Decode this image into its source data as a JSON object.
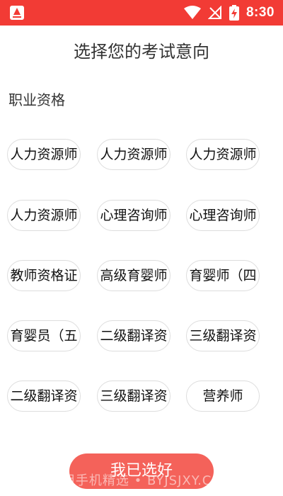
{
  "status_bar": {
    "time": "8:30",
    "background_color": "#f23b35",
    "icons": [
      "app-logo-icon",
      "wifi-icon",
      "no-signal-icon",
      "battery-charging-icon"
    ]
  },
  "header": {
    "title": "选择您的考试意向"
  },
  "section": {
    "title": "职业资格",
    "options": [
      "人力资源师",
      "人力资源师",
      "人力资源师",
      "人力资源师",
      "心理咨询师",
      "心理咨询师",
      "教师资格证",
      "高级育婴师",
      "育婴师（四",
      "育婴员（五",
      "二级翻译资",
      "三级翻译资",
      "二级翻译资",
      "三级翻译资",
      "营养师"
    ]
  },
  "footer": {
    "confirm_label": "我已选好",
    "button_color": "#f4625a",
    "watermark": "必用手机精选 • BYJSJXY.COM"
  }
}
